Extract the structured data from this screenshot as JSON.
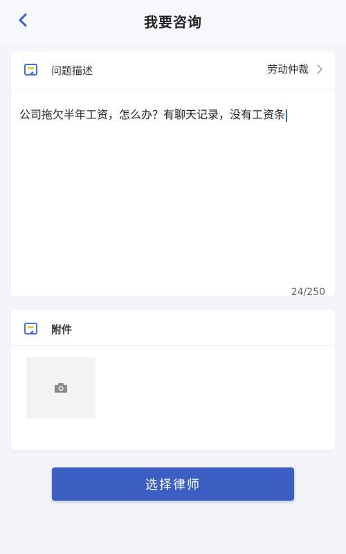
{
  "header": {
    "title": "我要咨询",
    "back_icon": "chevron-left-icon"
  },
  "problem": {
    "label": "问题描述",
    "category": "劳动仲裁",
    "text": "公司拖欠半年工资，怎么办？有聊天记录，没有工资条",
    "counter": "24/250",
    "icon": "note-edit-icon"
  },
  "attachment": {
    "label": "附件",
    "icon": "note-edit-icon",
    "upload_icon": "camera-icon"
  },
  "footer": {
    "button_label": "选择律师"
  },
  "colors": {
    "accent": "#3d5ec2",
    "icon_blue": "#3f6fe0",
    "icon_yellow": "#f4c542",
    "background": "#f3f5f9"
  }
}
